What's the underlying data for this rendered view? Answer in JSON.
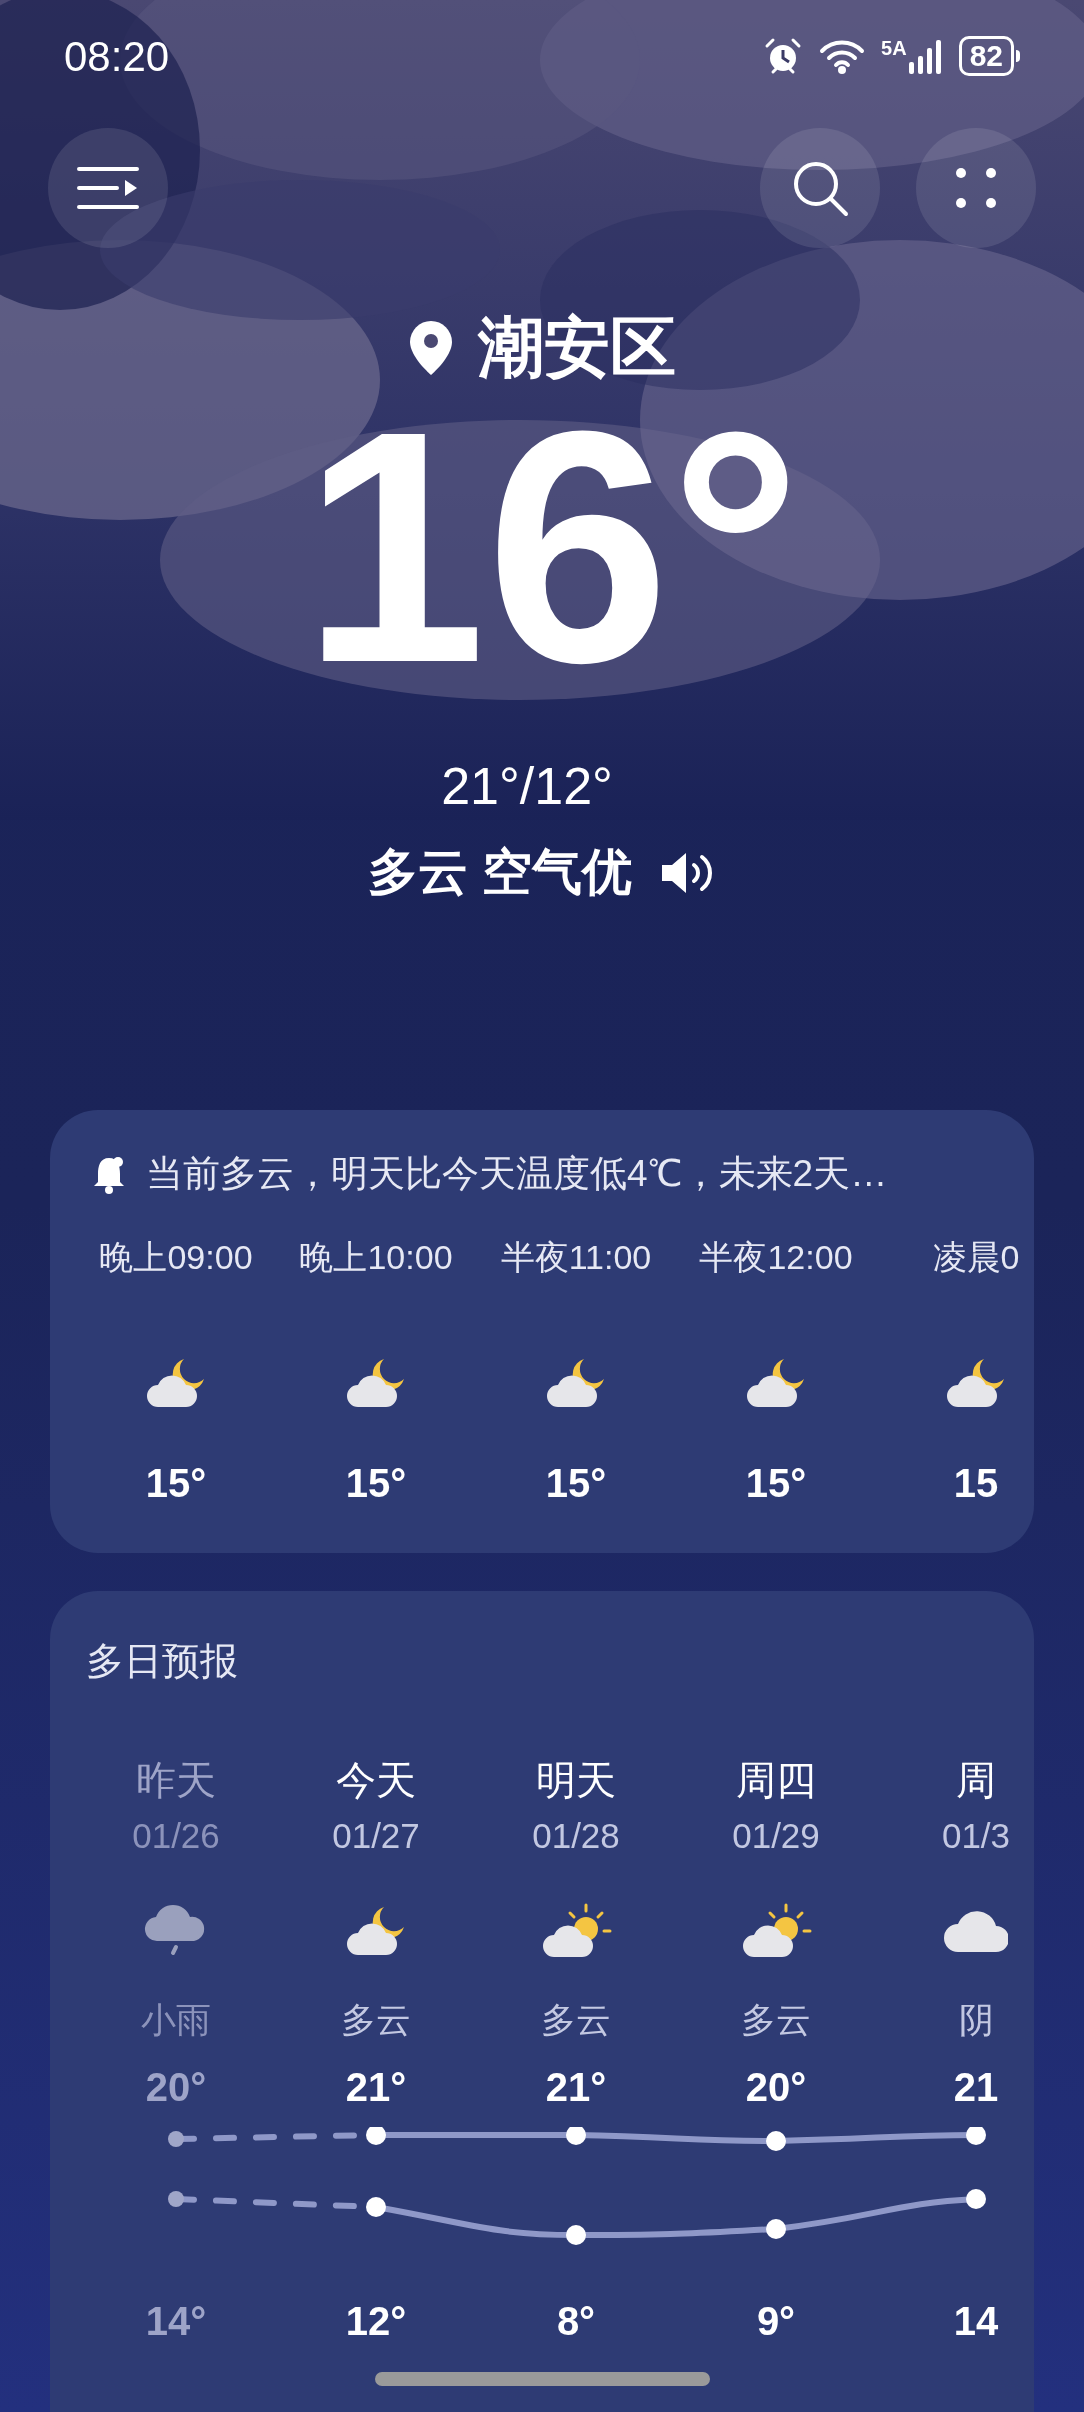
{
  "status_bar": {
    "time": "08:20",
    "network": "5A",
    "battery": "82"
  },
  "location": "潮安区",
  "temperature": "16°",
  "range": "21°/12°",
  "condition": "多云 空气优",
  "alert": "当前多云，明天比今天温度低4℃，未来2天…",
  "hourly": [
    {
      "time": "晚上09:00",
      "kind": "cloudy_night",
      "temp": "15°"
    },
    {
      "time": "晚上10:00",
      "kind": "cloudy_night",
      "temp": "15°"
    },
    {
      "time": "半夜11:00",
      "kind": "cloudy_night",
      "temp": "15°"
    },
    {
      "time": "半夜12:00",
      "kind": "cloudy_night",
      "temp": "15°"
    },
    {
      "time": "凌晨0",
      "kind": "cloudy_night",
      "temp": "15"
    }
  ],
  "daily": {
    "title": "多日预报",
    "days": [
      {
        "day": "昨天",
        "date": "01/26",
        "kind": "rain",
        "condition": "小雨",
        "high": "20°",
        "low": "14°",
        "past": true
      },
      {
        "day": "今天",
        "date": "01/27",
        "kind": "cloudy_night",
        "condition": "多云",
        "high": "21°",
        "low": "12°",
        "past": false
      },
      {
        "day": "明天",
        "date": "01/28",
        "kind": "cloudy_day",
        "condition": "多云",
        "high": "21°",
        "low": "8°",
        "past": false
      },
      {
        "day": "周四",
        "date": "01/29",
        "kind": "cloudy_day",
        "condition": "多云",
        "high": "20°",
        "low": "9°",
        "past": false
      },
      {
        "day": "周",
        "date": "01/3",
        "kind": "overcast",
        "condition": "阴",
        "high": "21",
        "low": "14",
        "past": false
      }
    ]
  }
}
